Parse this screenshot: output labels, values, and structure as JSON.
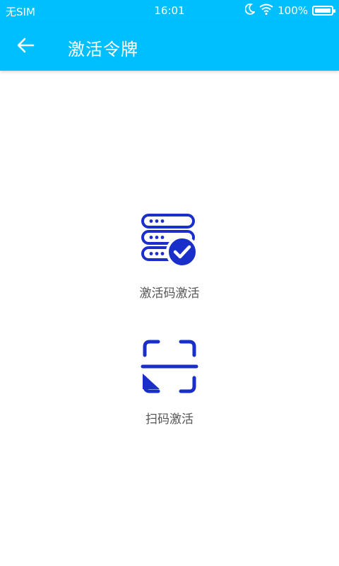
{
  "status_bar": {
    "carrier": "无SIM",
    "time": "16:01",
    "battery": "100%",
    "icons": [
      "moon-icon",
      "wifi-icon",
      "battery-icon"
    ]
  },
  "app_bar": {
    "back_icon": "arrow-left-icon",
    "title": "激活令牌"
  },
  "options": {
    "code_activation": {
      "icon": "server-check-icon",
      "label": "激活码激活"
    },
    "scan_activation": {
      "icon": "scan-frame-icon",
      "label": "扫码激活"
    }
  },
  "colors": {
    "primary": "#00BFFF",
    "icon_blue": "#1A2FC9",
    "label_text": "#555555"
  }
}
